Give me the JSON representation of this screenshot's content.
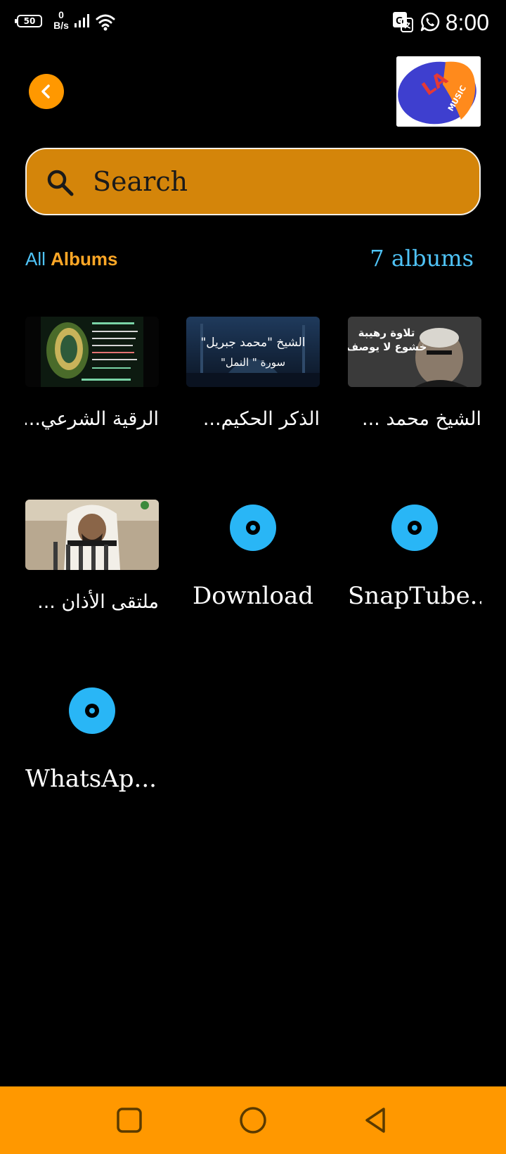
{
  "status_bar": {
    "battery": "50",
    "net_speed_value": "0",
    "net_speed_unit": "B/s",
    "time": "8:00"
  },
  "header": {
    "logo_letters": "LA",
    "logo_subtitle": "MUSIC"
  },
  "search": {
    "placeholder": "Search",
    "value": ""
  },
  "albums_header": {
    "all_label": "All",
    "albums_label": "Albums",
    "count_label": "7 albums"
  },
  "albums": [
    {
      "title": "الرقية الشرعي...",
      "thumbnail": "quran-book-image"
    },
    {
      "title": "الذكر الحكيم...",
      "thumbnail": "mosque-night-image"
    },
    {
      "title": "الشيخ محمد ...",
      "thumbnail": "sheikh-portrait-image"
    },
    {
      "title": "ملتقى الأذان ...",
      "thumbnail": "muezzin-image"
    },
    {
      "title": "Download",
      "thumbnail": "disc-icon"
    },
    {
      "title": "SnapTube...",
      "thumbnail": "disc-icon"
    },
    {
      "title": "WhatsAp...",
      "thumbnail": "disc-icon"
    }
  ],
  "thumbnail_texts": {
    "mosque_line1": "الشيخ \"محمد جبريل\"",
    "mosque_line2": "سورة \" النمل\"",
    "sheikh_line1": "تلاوة رهيبة",
    "sheikh_line2": "خشوع لا يوصف"
  },
  "colors": {
    "accent_orange": "#FF9800",
    "search_bg": "#D4850A",
    "accent_blue": "#4FC3F7",
    "background": "#000000"
  }
}
